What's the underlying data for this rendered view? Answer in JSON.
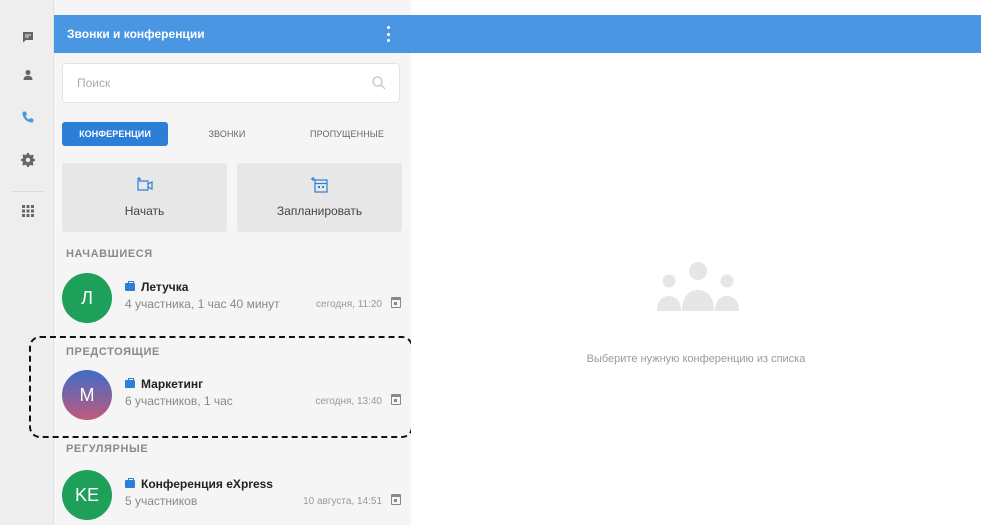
{
  "rail": {
    "items": [
      {
        "icon": "chat-icon",
        "color": "#666666"
      },
      {
        "icon": "contacts-icon",
        "color": "#666666"
      },
      {
        "icon": "phone-icon",
        "color": "#4a96e2"
      },
      {
        "icon": "gear-icon",
        "color": "#666666"
      },
      {
        "icon": "apps-grid-icon",
        "color": "#666666"
      }
    ]
  },
  "panel": {
    "title": "Звонки и конференции",
    "menu_icon": "kebab-menu-icon",
    "search": {
      "placeholder": "Поиск",
      "value": "",
      "icon": "search-icon"
    },
    "tabs": [
      {
        "label": "КОНФЕРЕНЦИИ",
        "active": true
      },
      {
        "label": "ЗВОНКИ",
        "active": false
      },
      {
        "label": "ПРОПУЩЕННЫЕ",
        "active": false
      }
    ],
    "actions": [
      {
        "label": "Начать",
        "icon": "video-add-icon"
      },
      {
        "label": "Запланировать",
        "icon": "calendar-add-icon"
      }
    ],
    "sections": [
      {
        "title": "НАЧАВШИЕСЯ",
        "items": [
          {
            "initials": "Л",
            "name": "Летучка",
            "details": "4 участника, 1 час 40 минут",
            "time": "сегодня, 11:20",
            "avatar_color": "#1fa05a"
          }
        ]
      },
      {
        "title": "ПРЕДСТОЯЩИЕ",
        "items": [
          {
            "initials": "М",
            "name": "Маркетинг",
            "details": "6 участников, 1 час",
            "time": "сегодня, 13:40",
            "avatar_color": "#7a5fa8"
          }
        ]
      },
      {
        "title": "РЕГУЛЯРНЫЕ",
        "items": [
          {
            "initials": "KE",
            "name": "Конференция eXpress",
            "details": "5 участников",
            "time": "10 августа, 14:51",
            "avatar_color": "#1fa05a"
          }
        ]
      }
    ]
  },
  "main": {
    "empty_text": "Выберите нужную конференцию из списка",
    "header_color": "#4a96e2",
    "illustration_icon": "people-group-icon"
  },
  "colors": {
    "accent": "#4a96e2",
    "tab_active": "#2c7fd6"
  }
}
